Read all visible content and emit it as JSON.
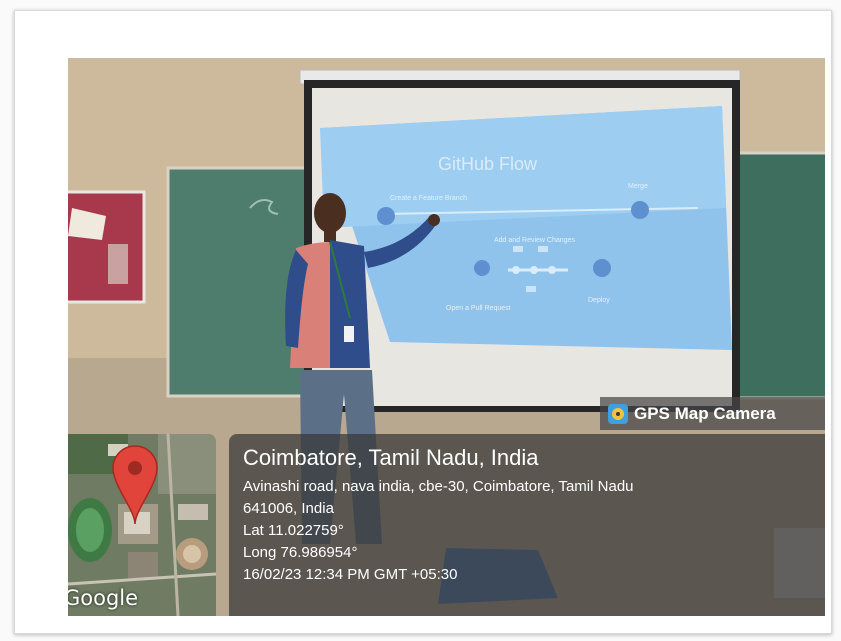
{
  "badge": {
    "icon": "gps-map-camera-icon",
    "label": "GPS Map Camera"
  },
  "slide": {
    "title": "GitHub Flow",
    "labels": [
      "Create a Feature Branch",
      "Merge",
      "Add and Review Changes",
      "Open a Pull Request",
      "Deploy"
    ]
  },
  "location": {
    "city": "Coimbatore, Tamil Nadu, India",
    "address_line1": "Avinashi road, nava india, cbe-30, Coimbatore, Tamil Nadu",
    "address_line2": "641006, India",
    "lat": "Lat 11.022759°",
    "long": "Long 76.986954°",
    "datetime": "16/02/23 12:34 PM GMT +05:30"
  },
  "map": {
    "brand": "Google",
    "pin_color": "#e0443a"
  }
}
